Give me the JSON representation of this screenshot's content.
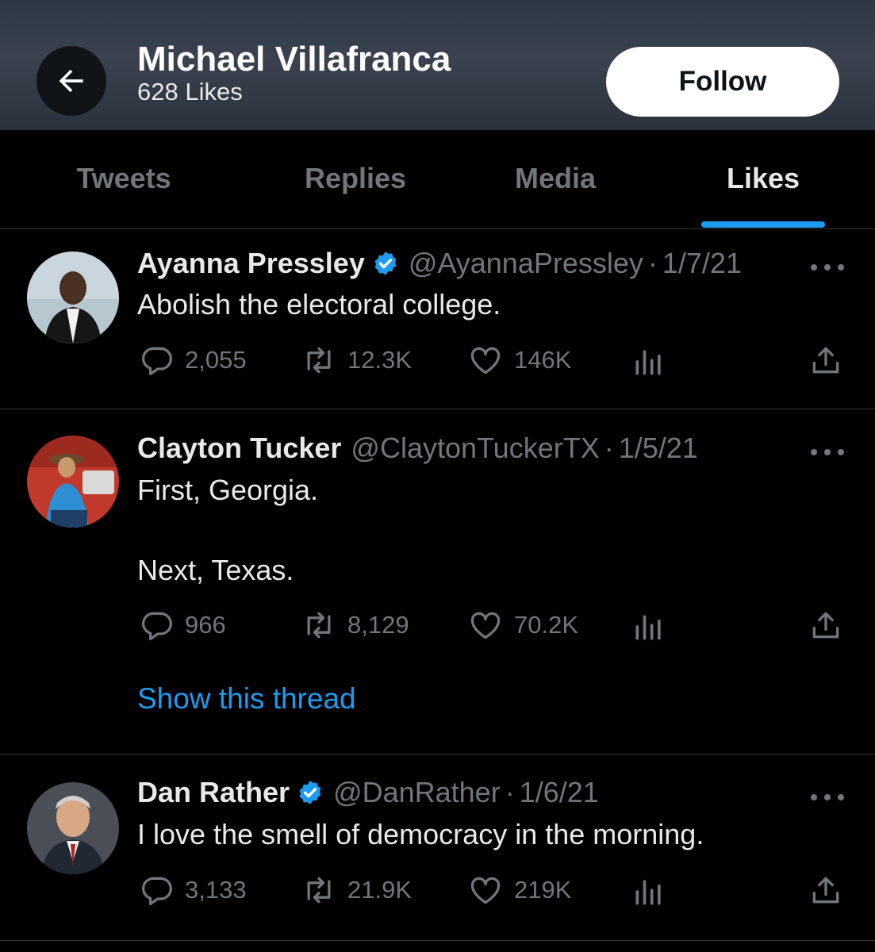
{
  "header": {
    "name": "Michael Villafranca",
    "subtitle": "628 Likes",
    "follow_label": "Follow"
  },
  "tabs": [
    {
      "label": "Tweets",
      "active": false
    },
    {
      "label": "Replies",
      "active": false
    },
    {
      "label": "Media",
      "active": false
    },
    {
      "label": "Likes",
      "active": true
    }
  ],
  "tweets": [
    {
      "author": "Ayanna Pressley",
      "verified": true,
      "handle": "@AyannaPressley",
      "separator": "·",
      "date": "1/7/21",
      "text": [
        "Abolish the electoral college."
      ],
      "replies": "2,055",
      "retweets": "12.3K",
      "likes": "146K"
    },
    {
      "author": "Clayton Tucker",
      "verified": false,
      "handle": "@ClaytonTuckerTX",
      "separator": "·",
      "date": "1/5/21",
      "text": [
        "First, Georgia.",
        "Next, Texas."
      ],
      "replies": "966",
      "retweets": "8,129",
      "likes": "70.2K",
      "show_thread": "Show this thread"
    },
    {
      "author": "Dan Rather",
      "verified": true,
      "handle": "@DanRather",
      "separator": "·",
      "date": "1/6/21",
      "text": [
        "I love the smell of democracy in the morning."
      ],
      "replies": "3,133",
      "retweets": "21.9K",
      "likes": "219K"
    }
  ],
  "colors": {
    "accent": "#1d9bf0",
    "muted": "#71767b",
    "text": "#e7e9ea",
    "background": "#000000"
  },
  "icons": [
    "back-arrow-icon",
    "verified-badge-icon",
    "more-icon",
    "reply-icon",
    "retweet-icon",
    "like-icon",
    "views-icon",
    "share-icon"
  ]
}
